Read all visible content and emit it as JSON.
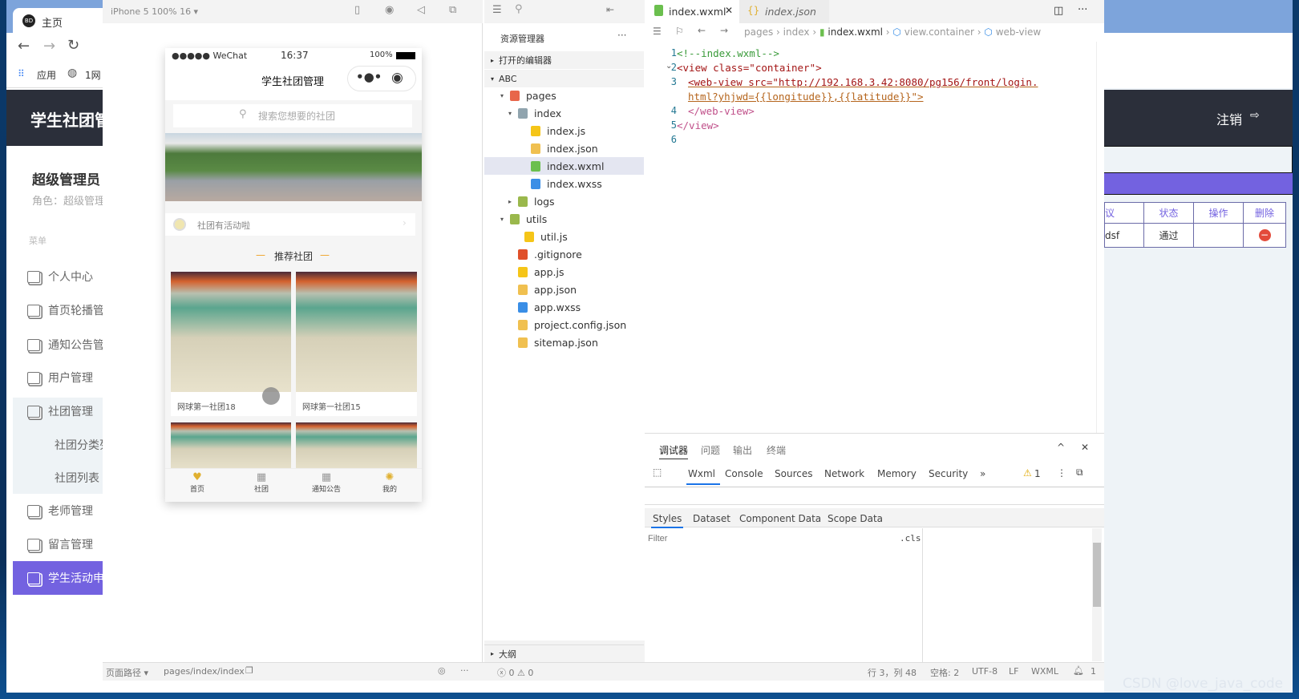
{
  "browser": {
    "tab_title": "主页",
    "bookmarks": [
      {
        "label": "应用"
      },
      {
        "label": "1网"
      }
    ],
    "window_controls": [
      "minimize",
      "maximize",
      "close"
    ]
  },
  "admin": {
    "header_title": "学生社团管",
    "logout": "注销",
    "user_name": "超级管理员",
    "role": "角色：超级管理",
    "menu_label": "菜单",
    "menu": [
      {
        "label": "个人中心"
      },
      {
        "label": "首页轮播管"
      },
      {
        "label": "通知公告管"
      },
      {
        "label": "用户管理"
      },
      {
        "label": "社团管理"
      },
      {
        "label": "社团分类列"
      },
      {
        "label": "社团列表"
      },
      {
        "label": "老师管理"
      },
      {
        "label": "留言管理"
      },
      {
        "label": "学生活动申"
      }
    ],
    "accent": "#7362e0",
    "table": {
      "headers": [
        "议",
        "状态",
        "操作",
        "删除"
      ],
      "row": [
        "dsf",
        "通过",
        "",
        ""
      ]
    }
  },
  "simulator": {
    "device": "iPhone 5 100% 16 ▾",
    "status": {
      "carrier": "●●●●● WeChat",
      "time": "16:37",
      "battery": "100%"
    },
    "nav_title": "学生社团管理",
    "search_placeholder": "搜索您想要的社团",
    "notice": "社团有活动啦",
    "section_title": "推荐社团",
    "cards": [
      {
        "name": "网球第一社团18"
      },
      {
        "name": "网球第一社团15"
      },
      {
        "name": ""
      },
      {
        "name": ""
      }
    ],
    "tabbar": [
      {
        "label": "首页"
      },
      {
        "label": "社团"
      },
      {
        "label": "通知公告"
      },
      {
        "label": "我的"
      }
    ]
  },
  "explorer": {
    "title": "资源管理器",
    "more": "···",
    "open_editors": "打开的编辑器",
    "project": "ABC",
    "tree": [
      {
        "label": "pages",
        "type": "folder-red"
      },
      {
        "label": "index",
        "type": "folder"
      },
      {
        "label": "index.js",
        "type": "js"
      },
      {
        "label": "index.json",
        "type": "json"
      },
      {
        "label": "index.wxml",
        "type": "wxml",
        "selected": true
      },
      {
        "label": "index.wxss",
        "type": "wxss"
      },
      {
        "label": "logs",
        "type": "folder-green"
      },
      {
        "label": "utils",
        "type": "folder-green"
      },
      {
        "label": "util.js",
        "type": "js"
      },
      {
        "label": ".gitignore",
        "type": "git"
      },
      {
        "label": "app.js",
        "type": "js"
      },
      {
        "label": "app.json",
        "type": "json"
      },
      {
        "label": "app.wxss",
        "type": "wxss"
      },
      {
        "label": "project.config.json",
        "type": "json"
      },
      {
        "label": "sitemap.json",
        "type": "json"
      }
    ],
    "outline": "大纲"
  },
  "editor": {
    "tabs": [
      {
        "label": "index.wxml",
        "active": true
      },
      {
        "label": "index.json",
        "active": false
      }
    ],
    "breadcrumb": [
      "pages",
      "index",
      "index.wxml",
      "view.container",
      "web-view"
    ],
    "lines": [
      {
        "n": "1",
        "text": "<!--index.wxml-->"
      },
      {
        "n": "2",
        "text": "<view class=\"container\">"
      },
      {
        "n": "3",
        "text": "<web-view src=\"http://192.168.3.42:8080/pg156/front/login."
      },
      {
        "n": "",
        "text": "html?yhjwd={{longitude}},{{latitude}}\">"
      },
      {
        "n": "4",
        "text": "</web-view>"
      },
      {
        "n": "5",
        "text": "</view>"
      },
      {
        "n": "6",
        "text": ""
      }
    ]
  },
  "debugger": {
    "panel_tabs": [
      "调试器",
      "问题",
      "输出",
      "终端"
    ],
    "dev_tabs": [
      "Wxml",
      "Console",
      "Sources",
      "Network",
      "Memory",
      "Security",
      "»"
    ],
    "warnings": "1",
    "sub_tabs": [
      "Styles",
      "Dataset",
      "Component Data",
      "Scope Data"
    ],
    "filter_placeholder": "Filter",
    "cls": ".cls"
  },
  "statusbar": {
    "page_path_label": "页面路径 ▾",
    "page_path": "pages/index/index",
    "errors": "ⓧ 0 ⚠ 0",
    "position": "行 3，列 48",
    "spaces": "空格: 2",
    "encoding": "UTF-8",
    "eol": "LF",
    "lang": "WXML",
    "notifications": "1"
  },
  "watermark": "CSDN @love_java_code"
}
